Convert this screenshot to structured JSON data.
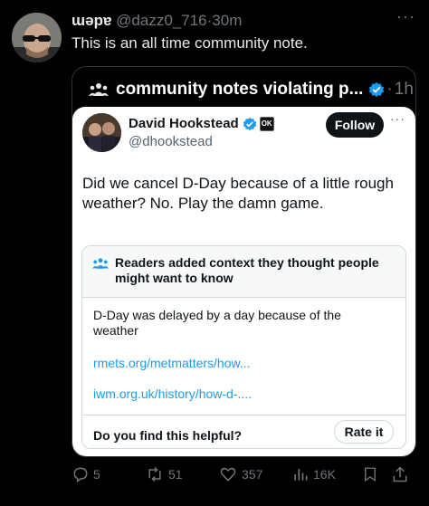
{
  "tweet": {
    "author_name": "ɯǝpɐ",
    "handle": "@dazz0_716",
    "separator": "·",
    "time": "30m",
    "text": "This is an all time community note.",
    "more": "···"
  },
  "quote": {
    "account_name": "community notes violating p...",
    "separator": "·",
    "time": "1h"
  },
  "card": {
    "author_name": "David Hookstead",
    "badge_text": "OK",
    "handle": "@dhookstead",
    "follow_label": "Follow",
    "more": "···",
    "text": "Did we cancel D-Day because of a little rough weather? No. Play the damn game."
  },
  "note": {
    "title": "Readers added context they thought people might want to know",
    "body": "D-Day was delayed by a day because of the weather",
    "link1": "rmets.org/metmatters/how...",
    "link2": "iwm.org.uk/history/how-d-....",
    "question": "Do you find this helpful?",
    "rate_label": "Rate it"
  },
  "actions": {
    "replies": "5",
    "reposts": "51",
    "likes": "357",
    "views": "16K"
  },
  "colors": {
    "background": "#000000",
    "accent": "#1d9bf0",
    "muted": "#71767b"
  }
}
